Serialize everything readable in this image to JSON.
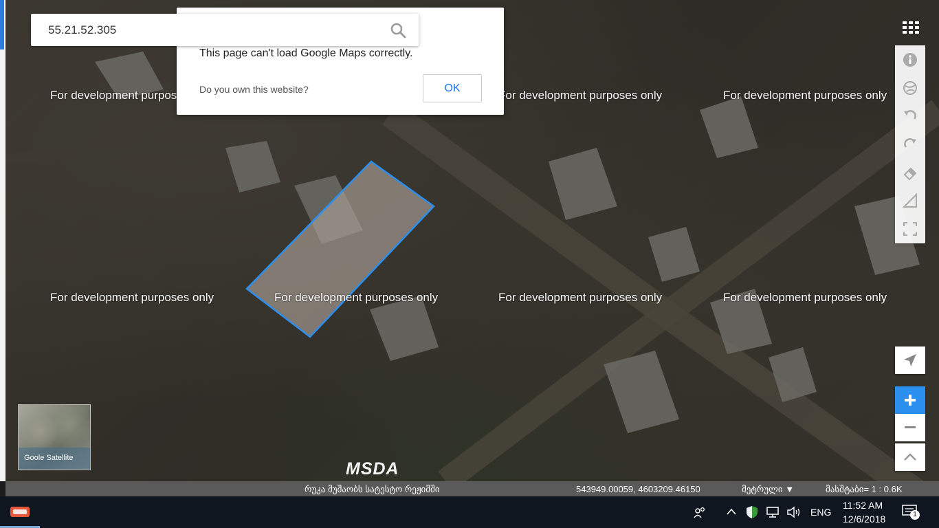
{
  "search": {
    "value": "55.21.52.305",
    "icon": "search-icon"
  },
  "dialog": {
    "message": "This page can't load Google Maps correctly.",
    "question": "Do you own this website?",
    "ok_label": "OK"
  },
  "map": {
    "watermark": "For development purposes only",
    "parcel_color": "#2b8ff0"
  },
  "tools": [
    {
      "name": "info-icon"
    },
    {
      "name": "globe-icon"
    },
    {
      "name": "undo-icon"
    },
    {
      "name": "redo-icon"
    },
    {
      "name": "eraser-icon"
    },
    {
      "name": "measure-area-icon"
    },
    {
      "name": "fullscreen-icon"
    }
  ],
  "minimap": {
    "label": "Goole Satellite"
  },
  "logo": {
    "text": "MSDA"
  },
  "statusbar": {
    "left_text": "რუკა მუშაობს სატესტო რეჟიმში",
    "coords": "543949.00059, 4603209.46150",
    "unit": "მეტრული ▼",
    "scale": "მასშტაბი= 1 : 0.6K"
  },
  "taskbar": {
    "language": "ENG",
    "time": "11:52 AM",
    "date": "12/6/2018",
    "notifications": "1"
  }
}
